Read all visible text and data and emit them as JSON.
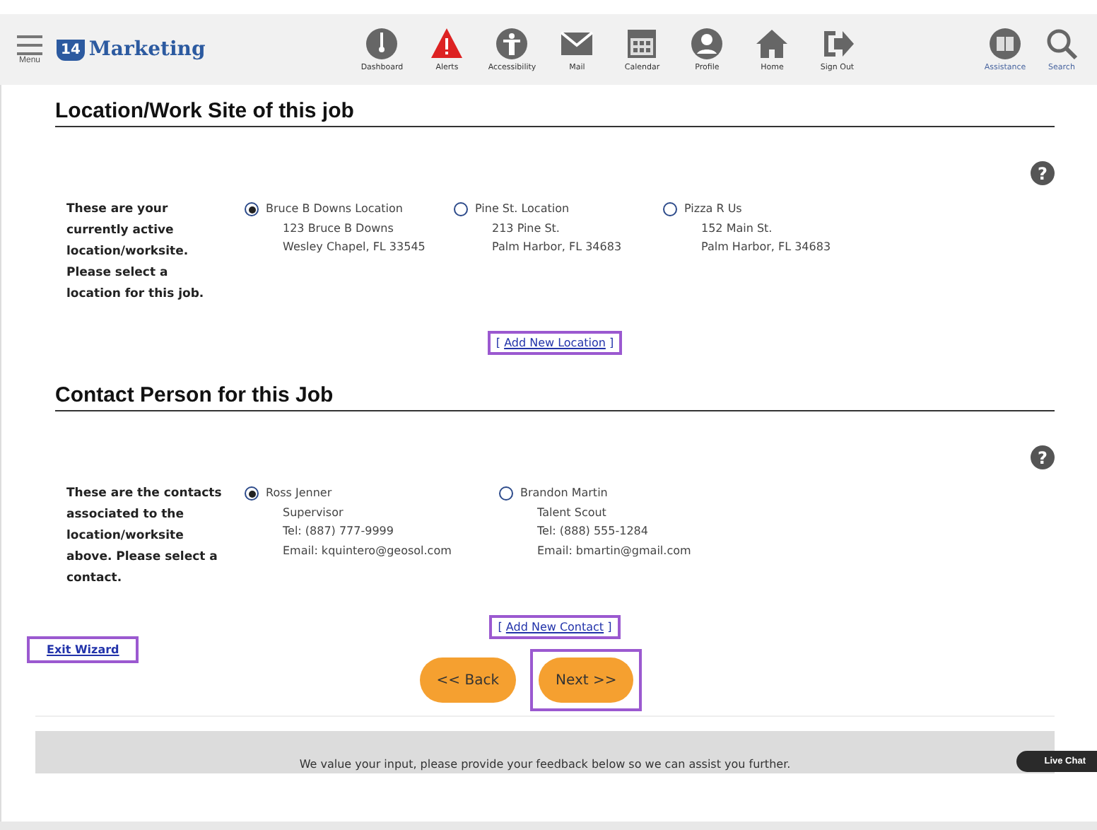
{
  "header": {
    "menu_label": "Menu",
    "logo_badge": "14",
    "logo_text": "Marketing",
    "nav": [
      {
        "kind": "dashboard",
        "label": "Dashboard"
      },
      {
        "kind": "alert",
        "label": "Alerts"
      },
      {
        "kind": "accessibility",
        "label": "Accessibility"
      },
      {
        "kind": "mail",
        "label": "Mail"
      },
      {
        "kind": "calendar",
        "label": "Calendar"
      },
      {
        "kind": "profile",
        "label": "Profile"
      },
      {
        "kind": "home",
        "label": "Home"
      },
      {
        "kind": "signout",
        "label": "Sign Out"
      }
    ],
    "tools": [
      {
        "kind": "book",
        "label": "Assistance"
      },
      {
        "kind": "search",
        "label": "Search"
      }
    ]
  },
  "sections": [
    {
      "title": "Location/Work Site of this job",
      "help": "?",
      "intro": "These are your currently active location/worksite. Please select a location for this job.",
      "options": [
        {
          "selected": true,
          "lines": [
            "Bruce B Downs Location",
            "123 Bruce B Downs",
            "Wesley Chapel, FL 33545"
          ]
        },
        {
          "selected": false,
          "lines": [
            "Pine St. Location",
            "213 Pine St.",
            "Palm Harbor, FL 34683"
          ]
        },
        {
          "selected": false,
          "lines": [
            "Pizza R Us",
            "152 Main St.",
            "Palm Harbor, FL 34683"
          ]
        }
      ],
      "add_link": {
        "open": "[",
        "label": "Add New Location",
        "close": "]",
        "highlighted": true
      }
    },
    {
      "title": "Contact Person for this Job",
      "help": "?",
      "intro": "These are the contacts associated to the location/worksite above. Please select a contact.",
      "options": [
        {
          "selected": true,
          "lines": [
            "Ross Jenner",
            "Supervisor",
            "Tel: (887) 777-9999",
            "Email: kquintero@geosol.com"
          ]
        },
        {
          "selected": false,
          "lines": [
            "Brandon Martin",
            "Talent Scout",
            "Tel: (888) 555-1284",
            "Email: bmartin@gmail.com"
          ]
        }
      ],
      "add_link": {
        "open": "[",
        "label": "Add New Contact",
        "close": "]",
        "highlighted": true
      }
    }
  ],
  "exit_link": {
    "label": "Exit Wizard",
    "highlighted": true
  },
  "buttons": [
    {
      "label": "<< Back",
      "highlighted": false
    },
    {
      "label": "Next >>",
      "highlighted": true
    }
  ],
  "live_chat": "Live Chat",
  "feedback": "We value your input, please provide your feedback below so we can assist you further."
}
